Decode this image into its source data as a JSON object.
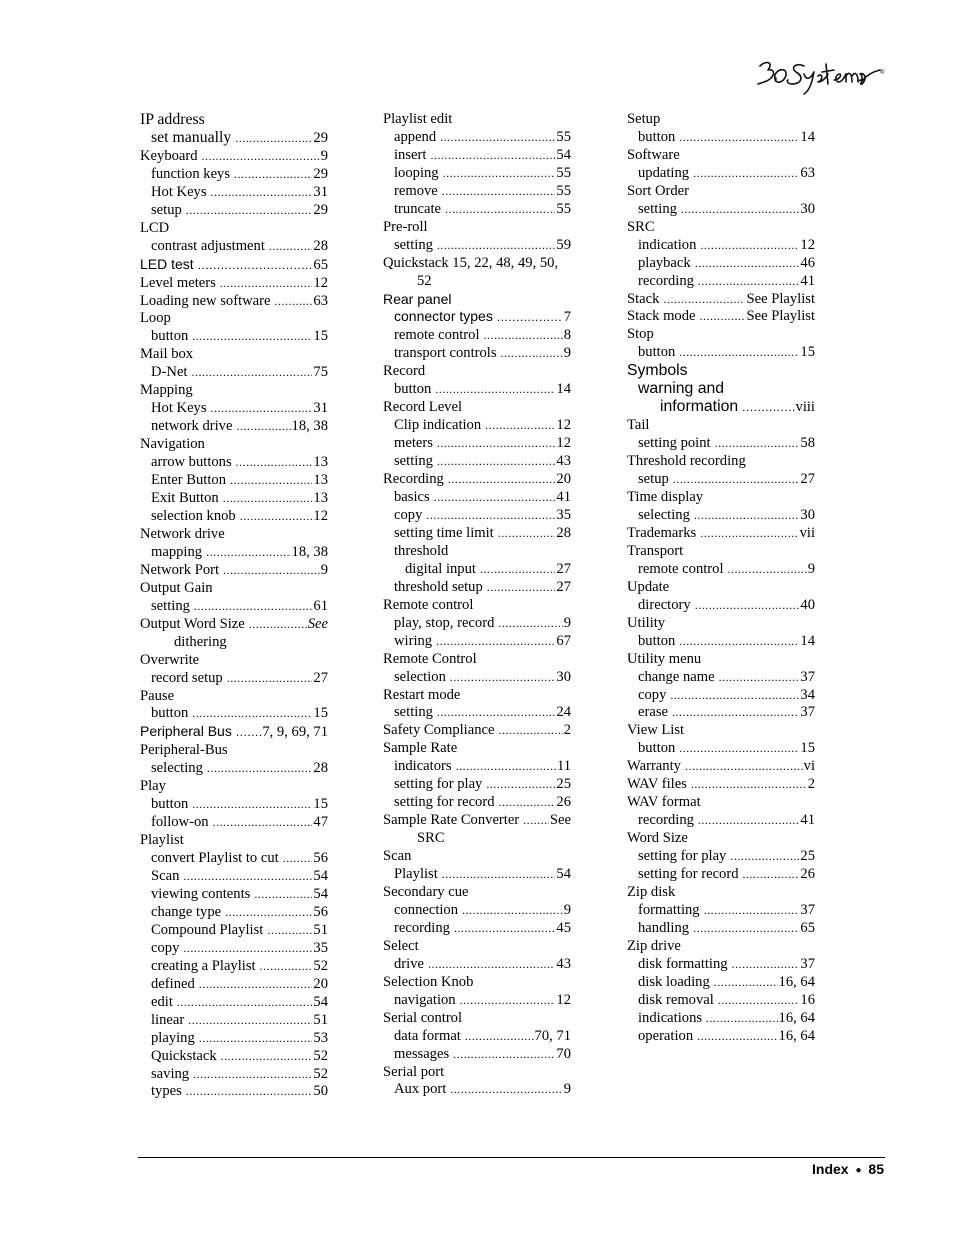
{
  "header": {
    "logo_text": "360 Systems",
    "logo_mark": "®"
  },
  "footer": {
    "section": "Index",
    "bullet": "●",
    "page_number": "85"
  },
  "columns": [
    [
      {
        "term": "IP address",
        "level": 0,
        "style": "big"
      },
      {
        "term": "set manually",
        "page": "29",
        "level": 1,
        "style": "big"
      },
      {
        "term": "Keyboard",
        "page": "9",
        "level": 0
      },
      {
        "term": "function keys",
        "page": "29",
        "level": 1
      },
      {
        "term": "Hot Keys",
        "page": "31",
        "level": 1
      },
      {
        "term": "setup",
        "page": "29",
        "level": 1
      },
      {
        "term": "LCD",
        "level": 0
      },
      {
        "term": "contrast adjustment",
        "page": "28",
        "level": 1
      },
      {
        "term": "LED test",
        "page": "65",
        "level": 0,
        "style": "sans"
      },
      {
        "term": "Level meters",
        "page": "12",
        "level": 0
      },
      {
        "term": "Loading new software",
        "page": "63",
        "level": 0
      },
      {
        "term": "Loop",
        "level": 0
      },
      {
        "term": "button",
        "page": "15",
        "level": 1
      },
      {
        "term": "Mail box",
        "level": 0
      },
      {
        "term": "D-Net",
        "page": "75",
        "level": 1
      },
      {
        "term": "Mapping",
        "level": 0
      },
      {
        "term": "Hot Keys",
        "page": "31",
        "level": 1
      },
      {
        "term": "network drive",
        "page": "18, 38",
        "level": 1
      },
      {
        "term": "Navigation",
        "level": 0
      },
      {
        "term": "arrow buttons",
        "page": "13",
        "level": 1
      },
      {
        "term": "Enter Button",
        "page": "13",
        "level": 1
      },
      {
        "term": "Exit Button",
        "page": "13",
        "level": 1
      },
      {
        "term": "selection knob",
        "page": "12",
        "level": 1
      },
      {
        "term": "Network drive",
        "level": 0
      },
      {
        "term": "mapping",
        "page": "18, 38",
        "level": 1
      },
      {
        "term": "Network Port",
        "page": "9",
        "level": 0
      },
      {
        "term": "Output Gain",
        "level": 0
      },
      {
        "term": "setting",
        "page": "61",
        "level": 1
      },
      {
        "term": "Output Word Size",
        "page": "See",
        "page_style": "italic",
        "level": 0,
        "continuation": "dithering"
      },
      {
        "term": "Overwrite",
        "level": 0
      },
      {
        "term": "record setup",
        "page": "27",
        "level": 1
      },
      {
        "term": "Pause",
        "level": 0
      },
      {
        "term": "button",
        "page": "15",
        "level": 1
      },
      {
        "term": "Peripheral Bus",
        "page": "7, 9, 69, 71",
        "level": 0,
        "style": "sans"
      },
      {
        "term": "Peripheral-Bus",
        "level": 0
      },
      {
        "term": "selecting",
        "page": "28",
        "level": 1
      },
      {
        "term": "Play",
        "level": 0
      },
      {
        "term": "button",
        "page": "15",
        "level": 1
      },
      {
        "term": "follow-on",
        "page": "47",
        "level": 1
      },
      {
        "term": "Playlist",
        "level": 0
      },
      {
        "term": "convert Playlist to cut",
        "page": "56",
        "level": 1
      },
      {
        "term": "Scan",
        "page": "54",
        "level": 1
      },
      {
        "term": "viewing contents",
        "page": "54",
        "level": 1
      },
      {
        "term": "change type",
        "page": "56",
        "level": 1
      },
      {
        "term": "Compound Playlist",
        "page": "51",
        "level": 1
      },
      {
        "term": "copy",
        "page": "35",
        "level": 1
      },
      {
        "term": "creating a Playlist",
        "page": "52",
        "level": 1
      },
      {
        "term": "defined",
        "page": "20",
        "level": 1
      },
      {
        "term": "edit",
        "page": "54",
        "level": 1
      },
      {
        "term": "linear",
        "page": "51",
        "level": 1
      },
      {
        "term": "playing",
        "page": "53",
        "level": 1
      },
      {
        "term": "Quickstack",
        "page": "52",
        "level": 1
      },
      {
        "term": "saving",
        "page": "52",
        "level": 1
      },
      {
        "term": "types",
        "page": "50",
        "level": 1
      }
    ],
    [
      {
        "term": "Playlist edit",
        "level": 0
      },
      {
        "term": "append",
        "page": "55",
        "level": 1
      },
      {
        "term": "insert",
        "page": "54",
        "level": 1
      },
      {
        "term": "looping",
        "page": "55",
        "level": 1
      },
      {
        "term": "remove",
        "page": "55",
        "level": 1
      },
      {
        "term": "truncate",
        "page": "55",
        "level": 1
      },
      {
        "term": "Pre-roll",
        "level": 0
      },
      {
        "term": "setting",
        "page": "59",
        "level": 1
      },
      {
        "term": "Quickstack 15, 22, 48, 49, 50,",
        "level": 0,
        "continuation": "52"
      },
      {
        "term": "Rear panel",
        "level": 0,
        "style": "sans"
      },
      {
        "term": "connector types",
        "page": "7",
        "level": 1,
        "style": "sans"
      },
      {
        "term": "remote control",
        "page": "8",
        "level": 1
      },
      {
        "term": "transport controls",
        "page": "9",
        "level": 1
      },
      {
        "term": "Record",
        "level": 0
      },
      {
        "term": "button",
        "page": "14",
        "level": 1
      },
      {
        "term": "Record Level",
        "level": 0
      },
      {
        "term": "Clip indication",
        "page": "12",
        "level": 1
      },
      {
        "term": "meters",
        "page": "12",
        "level": 1
      },
      {
        "term": "setting",
        "page": "43",
        "level": 1
      },
      {
        "term": "Recording",
        "page": "20",
        "level": 0
      },
      {
        "term": "basics",
        "page": "41",
        "level": 1
      },
      {
        "term": "copy",
        "page": "35",
        "level": 1
      },
      {
        "term": "setting time limit",
        "page": "28",
        "level": 1
      },
      {
        "term": "threshold",
        "level": 1
      },
      {
        "term": "digital input",
        "page": "27",
        "level": 2
      },
      {
        "term": "threshold setup",
        "page": "27",
        "level": 1
      },
      {
        "term": "Remote control",
        "level": 0
      },
      {
        "term": "play, stop, record",
        "page": "9",
        "level": 1
      },
      {
        "term": "wiring",
        "page": "67",
        "level": 1
      },
      {
        "term": "Remote Control",
        "level": 0
      },
      {
        "term": "selection",
        "page": "30",
        "level": 1
      },
      {
        "term": "Restart mode",
        "level": 0
      },
      {
        "term": "setting",
        "page": "24",
        "level": 1
      },
      {
        "term": "Safety Compliance",
        "page": "2",
        "level": 0
      },
      {
        "term": "Sample Rate",
        "level": 0
      },
      {
        "term": "indicators",
        "page": "11",
        "level": 1
      },
      {
        "term": "setting for play",
        "page": "25",
        "level": 1
      },
      {
        "term": "setting for record",
        "page": "26",
        "level": 1
      },
      {
        "term": "Sample Rate Converter",
        "page": "See",
        "level": 0,
        "continuation": "SRC"
      },
      {
        "term": "Scan",
        "level": 0
      },
      {
        "term": "Playlist",
        "page": "54",
        "level": 1
      },
      {
        "term": "Secondary cue",
        "level": 0
      },
      {
        "term": "connection",
        "page": "9",
        "level": 1
      },
      {
        "term": "recording",
        "page": "45",
        "level": 1
      },
      {
        "term": "Select",
        "level": 0
      },
      {
        "term": "drive",
        "page": "43",
        "level": 1
      },
      {
        "term": "Selection Knob",
        "level": 0
      },
      {
        "term": "navigation",
        "page": "12",
        "level": 1
      },
      {
        "term": "Serial control",
        "level": 0
      },
      {
        "term": "data format",
        "page": "70, 71",
        "level": 1
      },
      {
        "term": "messages",
        "page": "70",
        "level": 1
      },
      {
        "term": "Serial port",
        "level": 0
      },
      {
        "term": "Aux port",
        "page": "9",
        "level": 1
      }
    ],
    [
      {
        "term": "Setup",
        "level": 0
      },
      {
        "term": "button",
        "page": "14",
        "level": 1
      },
      {
        "term": "Software",
        "level": 0
      },
      {
        "term": "updating",
        "page": "63",
        "level": 1
      },
      {
        "term": "Sort Order",
        "level": 0
      },
      {
        "term": "setting",
        "page": "30",
        "level": 1
      },
      {
        "term": "SRC",
        "level": 0
      },
      {
        "term": "indication",
        "page": "12",
        "level": 1
      },
      {
        "term": "playback",
        "page": "46",
        "level": 1
      },
      {
        "term": "recording",
        "page": "41",
        "level": 1
      },
      {
        "term": "Stack",
        "page": "See Playlist",
        "level": 0
      },
      {
        "term": "Stack mode",
        "page": "See Playlist",
        "level": 0
      },
      {
        "term": "Stop",
        "level": 0
      },
      {
        "term": "button",
        "page": "15",
        "level": 1
      },
      {
        "term": "Symbols",
        "level": 0,
        "style": "sans big"
      },
      {
        "term": "warning and",
        "level": 1,
        "style": "sans big"
      },
      {
        "term": "information",
        "page": "viii",
        "level": 3,
        "style": "sans big"
      },
      {
        "term": "Tail",
        "level": 0
      },
      {
        "term": "setting point",
        "page": "58",
        "level": 1
      },
      {
        "term": "Threshold recording",
        "level": 0
      },
      {
        "term": "setup",
        "page": "27",
        "level": 1
      },
      {
        "term": "Time display",
        "level": 0
      },
      {
        "term": "selecting",
        "page": "30",
        "level": 1
      },
      {
        "term": "Trademarks",
        "page": "vii",
        "level": 0
      },
      {
        "term": "Transport",
        "level": 0
      },
      {
        "term": "remote control",
        "page": "9",
        "level": 1
      },
      {
        "term": "Update",
        "level": 0
      },
      {
        "term": "directory",
        "page": "40",
        "level": 1
      },
      {
        "term": "Utility",
        "level": 0
      },
      {
        "term": "button",
        "page": "14",
        "level": 1
      },
      {
        "term": "Utility menu",
        "level": 0
      },
      {
        "term": "change name",
        "page": "37",
        "level": 1
      },
      {
        "term": "copy",
        "page": "34",
        "level": 1
      },
      {
        "term": "erase",
        "page": "37",
        "level": 1
      },
      {
        "term": "View List",
        "level": 0
      },
      {
        "term": "button",
        "page": "15",
        "level": 1
      },
      {
        "term": "Warranty",
        "page": "vi",
        "level": 0
      },
      {
        "term": "WAV files",
        "page": "2",
        "level": 0
      },
      {
        "term": "WAV format",
        "level": 0
      },
      {
        "term": "recording",
        "page": "41",
        "level": 1
      },
      {
        "term": "Word Size",
        "level": 0
      },
      {
        "term": "setting for play",
        "page": "25",
        "level": 1
      },
      {
        "term": "setting for record",
        "page": "26",
        "level": 1
      },
      {
        "term": "Zip disk",
        "level": 0
      },
      {
        "term": "formatting",
        "page": "37",
        "level": 1
      },
      {
        "term": "handling",
        "page": "65",
        "level": 1
      },
      {
        "term": "Zip drive",
        "level": 0
      },
      {
        "term": "disk formatting",
        "page": "37",
        "level": 1
      },
      {
        "term": "disk loading",
        "page": "16, 64",
        "level": 1
      },
      {
        "term": "disk removal",
        "page": "16",
        "level": 1
      },
      {
        "term": "indications",
        "page": "16, 64",
        "level": 1
      },
      {
        "term": "operation",
        "page": "16, 64",
        "level": 1
      }
    ]
  ]
}
